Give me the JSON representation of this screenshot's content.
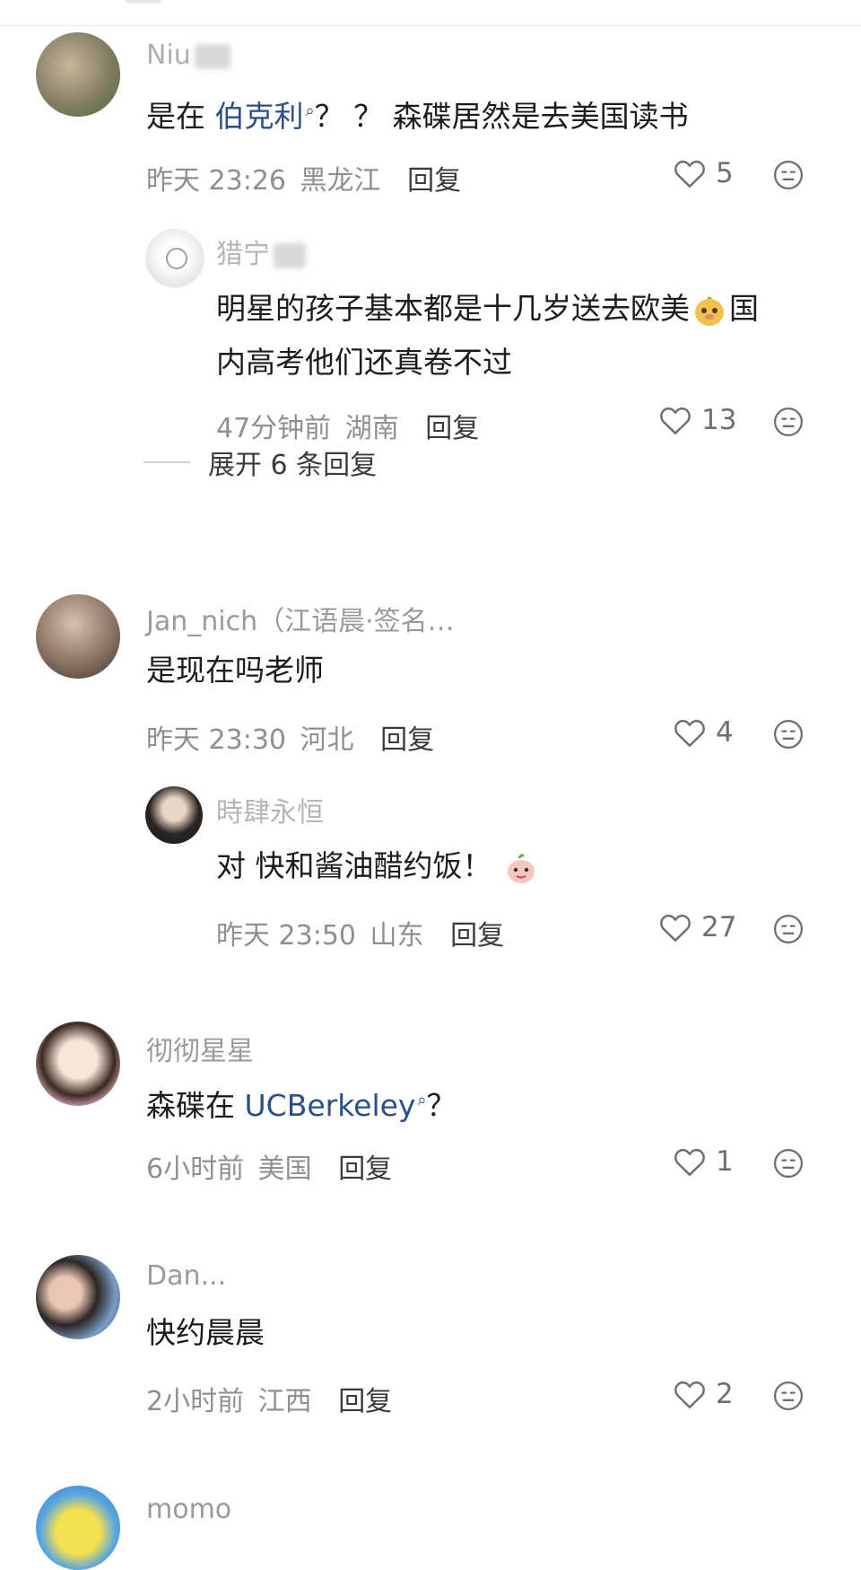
{
  "comments": [
    {
      "username": "Niu",
      "text_before": "是在 ",
      "link": "伯克利",
      "text_after": "？ ？ 森碟居然是去美国读书",
      "time": "昨天 23:26",
      "location": "黑龙江",
      "reply_label": "回复",
      "likes": "5",
      "replies": [
        {
          "username": "猎宁",
          "text_line1": "明星的孩子基本都是十几岁送去欧美",
          "text_line1_end": "国",
          "text_line2": "内高考他们还真卷不过",
          "time": "47分钟前",
          "location": "湖南",
          "reply_label": "回复",
          "likes": "13"
        }
      ],
      "expand_label": "展开 6 条回复"
    },
    {
      "username": "Jan_nich（江语晨·签名…",
      "text": "是现在吗老师",
      "time": "昨天 23:30",
      "location": "河北",
      "reply_label": "回复",
      "likes": "4",
      "replies": [
        {
          "username": "時肆永恒",
          "text": "对 快和酱油醋约饭！",
          "time": "昨天 23:50",
          "location": "山东",
          "reply_label": "回复",
          "likes": "27"
        }
      ]
    },
    {
      "username": "彻彻星星",
      "text_before": "森碟在 ",
      "link": "UCBerkeley",
      "text_after": "？",
      "time": "6小时前",
      "location": "美国",
      "reply_label": "回复",
      "likes": "1"
    },
    {
      "username": "Dan...",
      "text": "快约晨晨",
      "time": "2小时前",
      "location": "江西",
      "reply_label": "回复",
      "likes": "2"
    },
    {
      "username": "momo"
    }
  ],
  "colors": {
    "link": "#2b4f86",
    "meta": "#8f8f8f",
    "username": "#8a8a8a"
  },
  "icons": [
    "heart-icon",
    "dislike-face-icon",
    "search-mini-icon",
    "emoji-pear-icon"
  ]
}
